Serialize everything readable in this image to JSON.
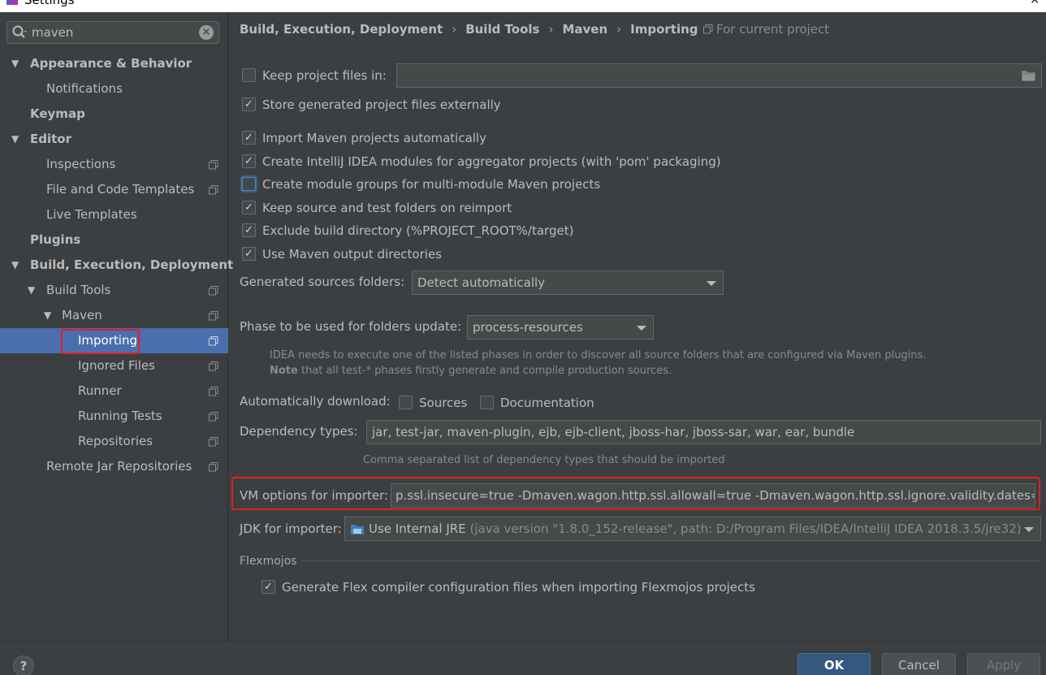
{
  "window": {
    "title": "Settings"
  },
  "search": {
    "value": "maven"
  },
  "sidebar": {
    "items": [
      {
        "label": "Appearance & Behavior"
      },
      {
        "label": "Notifications"
      },
      {
        "label": "Keymap"
      },
      {
        "label": "Editor"
      },
      {
        "label": "Inspections"
      },
      {
        "label": "File and Code Templates"
      },
      {
        "label": "Live Templates"
      },
      {
        "label": "Plugins"
      },
      {
        "label": "Build, Execution, Deployment"
      },
      {
        "label": "Build Tools"
      },
      {
        "label": "Maven"
      },
      {
        "label": "Importing"
      },
      {
        "label": "Ignored Files"
      },
      {
        "label": "Runner"
      },
      {
        "label": "Running Tests"
      },
      {
        "label": "Repositories"
      },
      {
        "label": "Remote Jar Repositories"
      }
    ]
  },
  "breadcrumb": {
    "items": [
      "Build, Execution, Deployment",
      "Build Tools",
      "Maven",
      "Importing"
    ],
    "scope": "For current project"
  },
  "form": {
    "keep_project_files": {
      "label": "Keep project files in:",
      "checked": false,
      "value": ""
    },
    "store_external": {
      "label": "Store generated project files externally",
      "checked": true
    },
    "import_auto": {
      "label": "Import Maven projects automatically",
      "checked": true
    },
    "create_modules": {
      "label": "Create IntelliJ IDEA modules for aggregator projects (with 'pom' packaging)",
      "checked": true
    },
    "module_groups": {
      "label": "Create module groups for multi-module Maven projects",
      "checked": false
    },
    "keep_source": {
      "label": "Keep source and test folders on reimport",
      "checked": true
    },
    "exclude_build": {
      "label": "Exclude build directory (%PROJECT_ROOT%/target)",
      "checked": true
    },
    "use_output": {
      "label": "Use Maven output directories",
      "checked": true
    },
    "generated_sources": {
      "label": "Generated sources folders:",
      "value": "Detect automatically"
    },
    "phase": {
      "label": "Phase to be used for folders update:",
      "value": "process-resources"
    },
    "phase_hint_1": "IDEA needs to execute one of the listed phases in order to discover all source folders that are configured via Maven plugins.",
    "phase_hint_note": "Note",
    "phase_hint_2": " that all test-* phases firstly generate and compile production sources.",
    "auto_download": {
      "label": "Automatically download:",
      "sources": "Sources",
      "documentation": "Documentation",
      "sources_checked": false,
      "documentation_checked": false
    },
    "dependency_types": {
      "label": "Dependency types:",
      "value": "jar, test-jar, maven-plugin, ejb, ejb-client, jboss-har, jboss-sar, war, ear, bundle",
      "hint": "Comma separated list of dependency types that should be imported"
    },
    "vm_options": {
      "label": "VM options for importer:",
      "value": "p.ssl.insecure=true -Dmaven.wagon.http.ssl.allowall=true -Dmaven.wagon.http.ssl.ignore.validity.dates=true"
    },
    "jdk": {
      "label": "JDK for importer:",
      "value": "Use Internal JRE",
      "detail": "(java version \"1.8.0_152-release\", path: D:/Program Files/IDEA/IntelliJ IDEA 2018.3.5/jre32)"
    },
    "flexmojos": {
      "section": "Flexmojos",
      "label": "Generate Flex compiler configuration files when importing Flexmojos projects",
      "checked": true
    }
  },
  "buttons": {
    "help": "?",
    "ok": "OK",
    "cancel": "Cancel",
    "apply": "Apply"
  },
  "colors": {
    "background": "#3c3f41",
    "selection": "#4b6eaf",
    "primary_button": "#365880",
    "highlight": "#e0201c"
  }
}
